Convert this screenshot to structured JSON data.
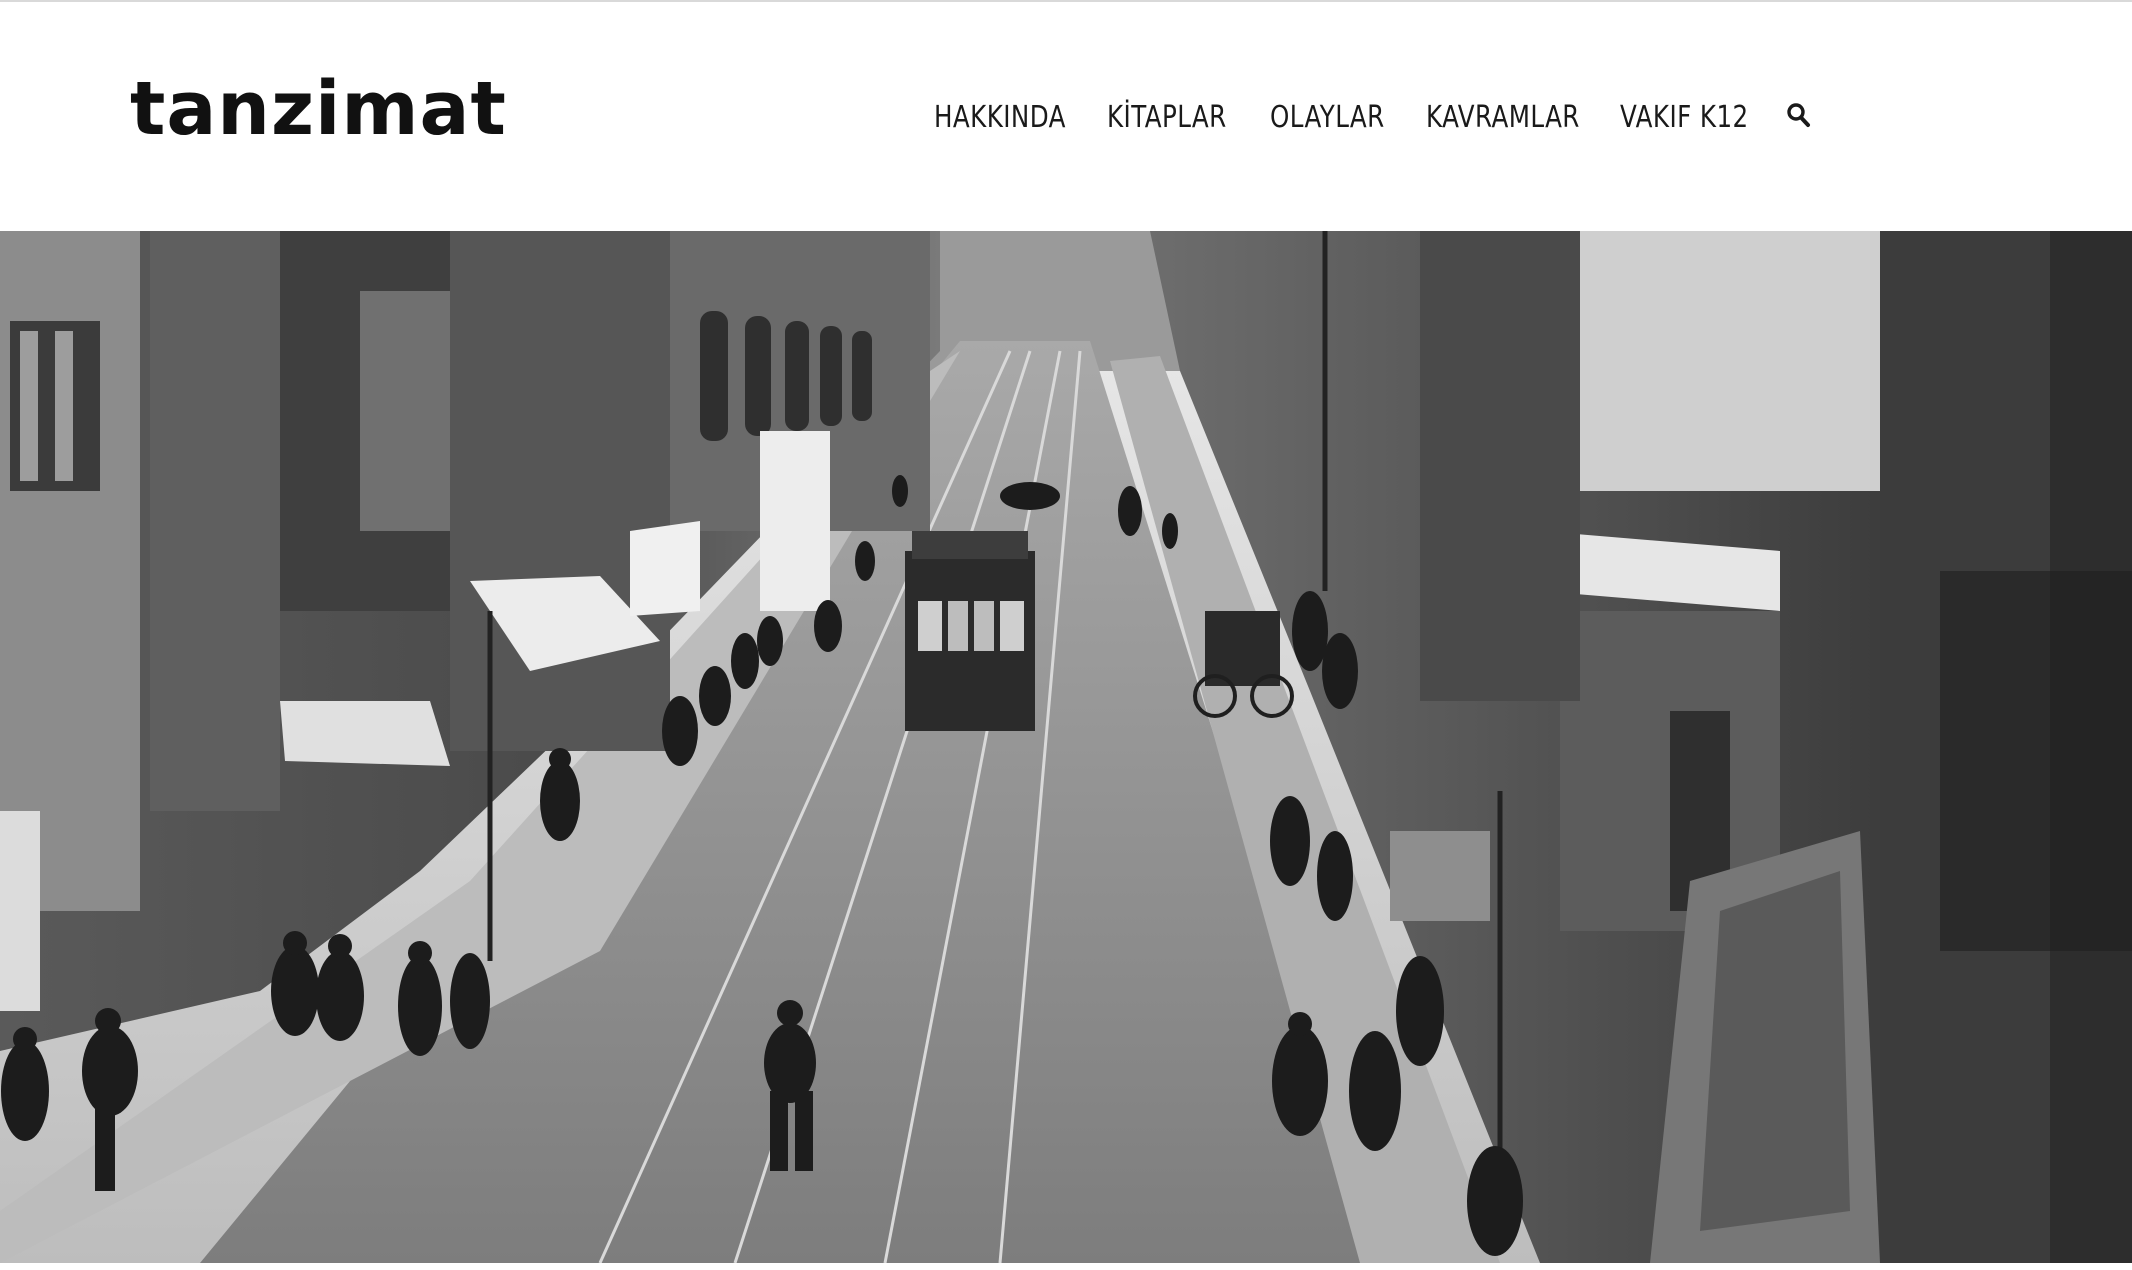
{
  "site": {
    "logo_text": "tanzimat"
  },
  "nav": {
    "items": [
      {
        "label": "HAKKINDA"
      },
      {
        "label": "KİTAPLAR"
      },
      {
        "label": "OLAYLAR"
      },
      {
        "label": "KAVRAMLAR"
      },
      {
        "label": "VAKIF K12"
      }
    ],
    "search_icon": "search-icon"
  },
  "hero": {
    "image_icon": "historic-street-photo",
    "palette": {
      "sky": "#e4e4e4",
      "road": "#8a8a8a",
      "sidewalk": "#b8b8b8",
      "building_dark": "#3a3a3a",
      "building_mid": "#6e6e6e",
      "building_light": "#a7a7a7",
      "awning": "#e9e9e9",
      "figure": "#1e1e1e"
    }
  }
}
